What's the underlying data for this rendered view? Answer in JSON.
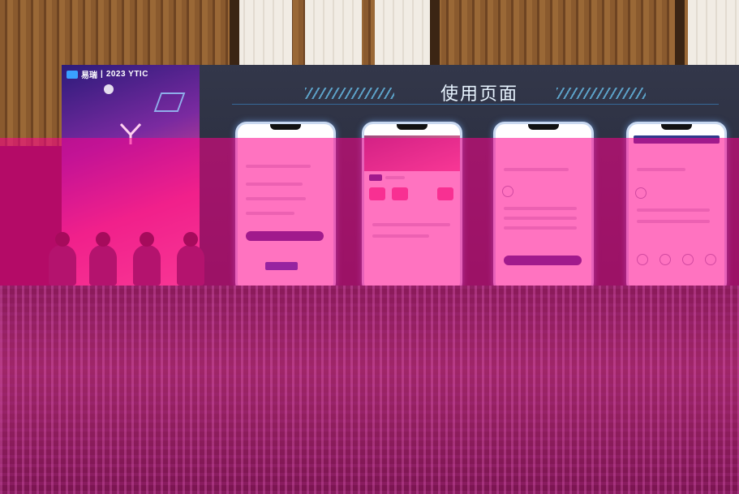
{
  "banner": {
    "brand": "易瑞",
    "event": "2023 YTIC"
  },
  "screen": {
    "title": "使用页面"
  },
  "phones": [
    {
      "name": "login-screen"
    },
    {
      "name": "home-screen"
    },
    {
      "name": "report-screen"
    },
    {
      "name": "profile-screen"
    }
  ],
  "colors": {
    "accent": "#2f3a8c",
    "overlay": "#ff008c",
    "screen_bg": "#2a2e40"
  }
}
